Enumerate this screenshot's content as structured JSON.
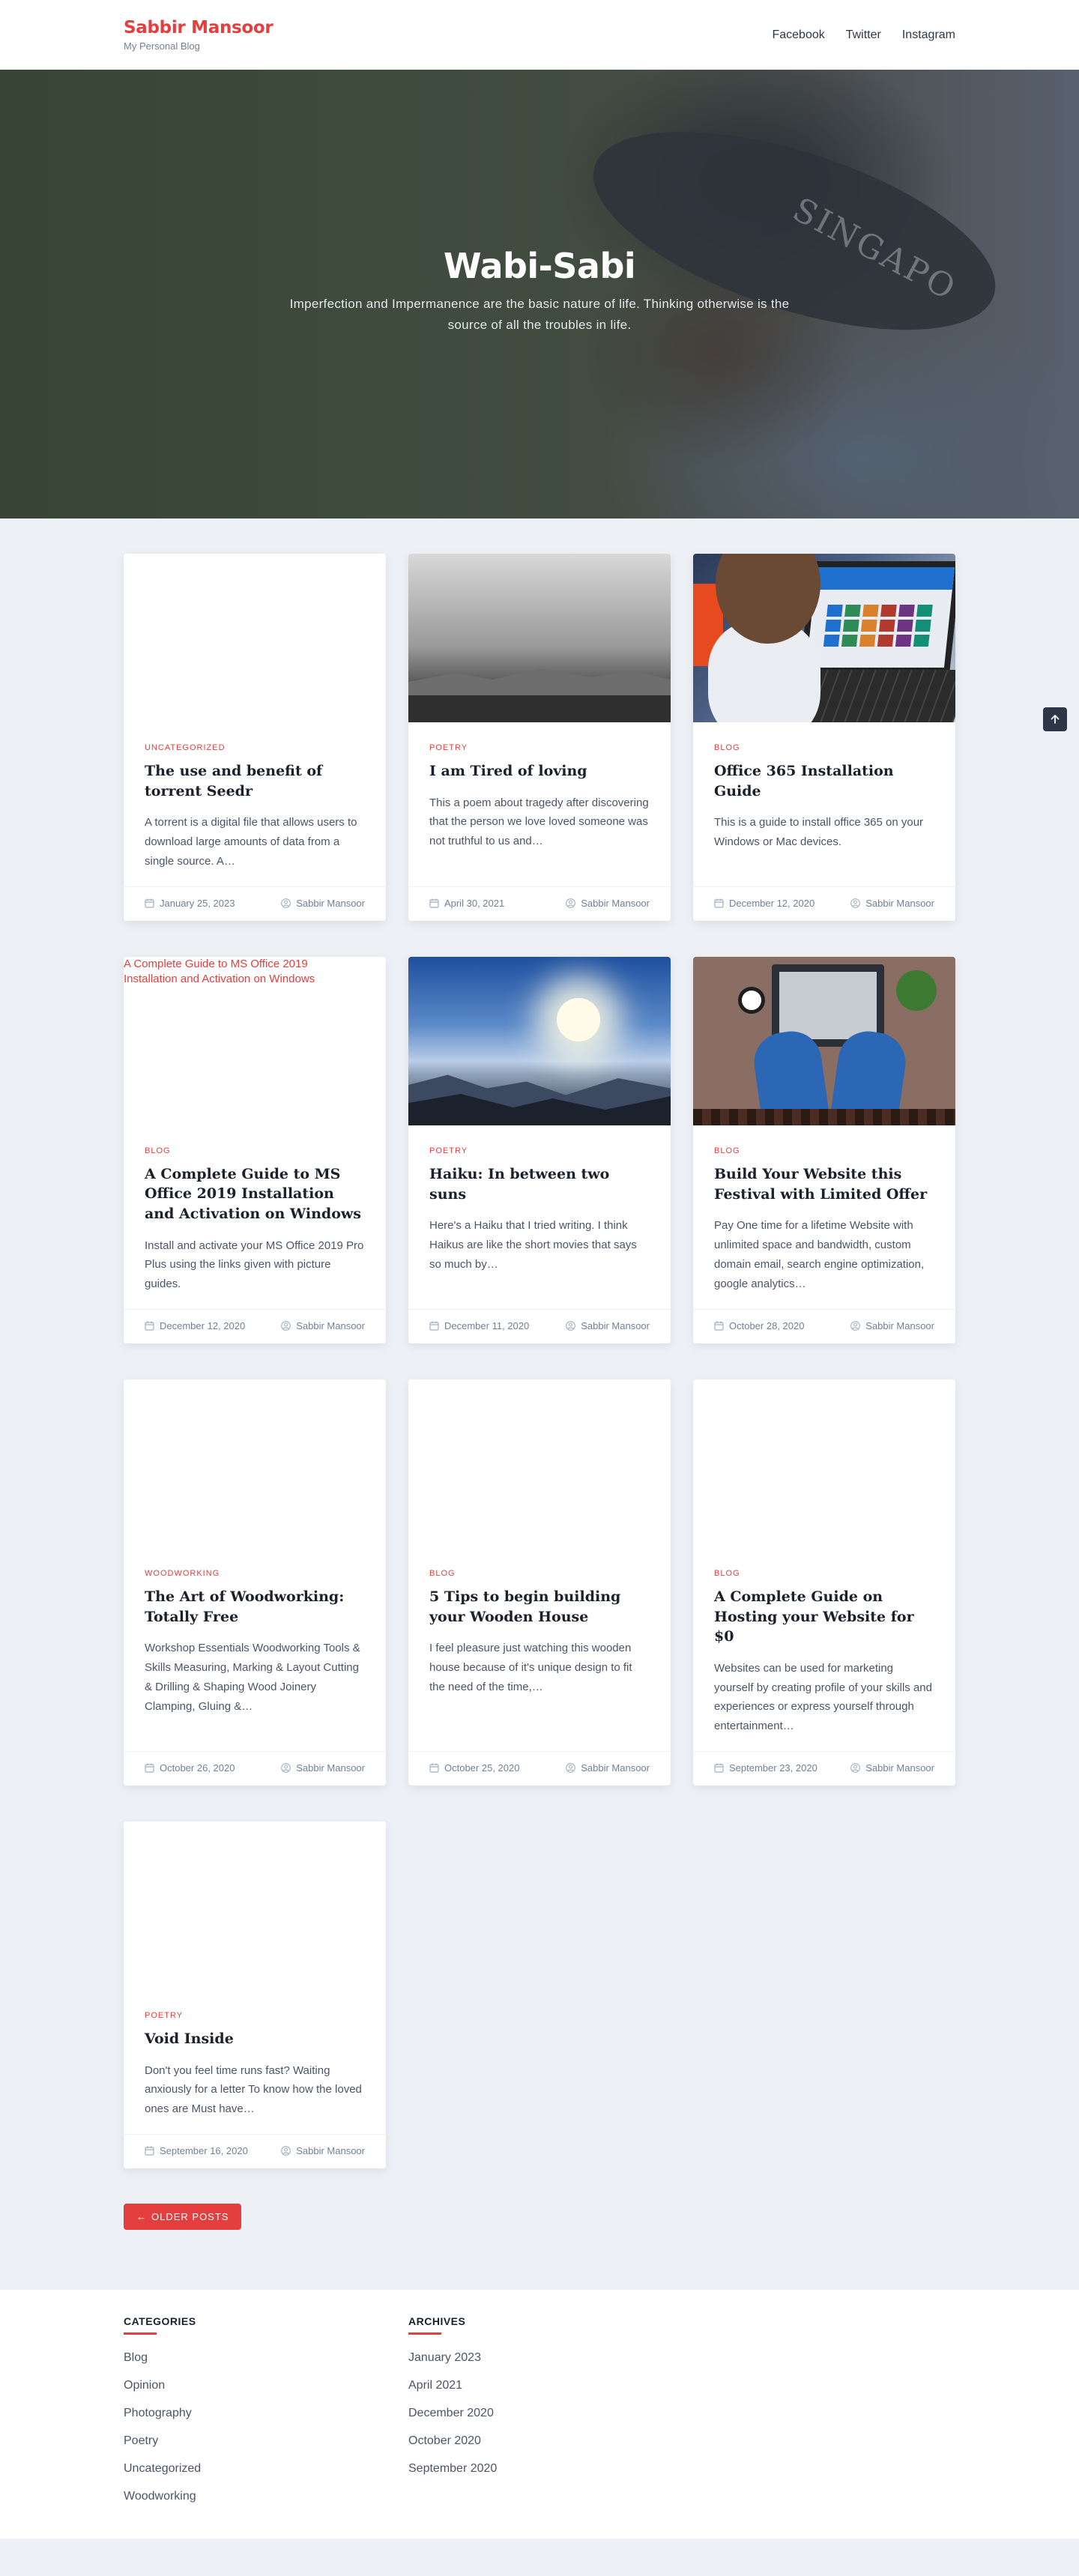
{
  "site": {
    "title": "Sabbir Mansoor",
    "tagline": "My Personal Blog"
  },
  "nav": [
    {
      "label": "Facebook"
    },
    {
      "label": "Twitter"
    },
    {
      "label": "Instagram"
    }
  ],
  "hero": {
    "title": "Wabi-Sabi",
    "subtitle": "Imperfection and Impermanence are the basic nature of life. Thinking otherwise is the source of all the troubles in life.",
    "hat_text": "SINGAPO"
  },
  "posts": [
    {
      "category": "UNCATEGORIZED",
      "title": "The use and benefit of torrent Seedr",
      "excerpt": "A torrent is a digital file that allows users to download large amounts of data from a single source. A…",
      "date": "January 25, 2023",
      "author": "Sabbir Mansoor"
    },
    {
      "category": "POETRY",
      "title": "I am Tired of loving",
      "excerpt": "This a poem about tragedy after discovering that the person we love loved someone was not truthful to us and…",
      "date": "April 30, 2021",
      "author": "Sabbir Mansoor",
      "image": "sculpture"
    },
    {
      "category": "BLOG",
      "title": "Office 365 Installation Guide",
      "excerpt": "This is a guide to install office 365 on your Windows or Mac devices.",
      "date": "December 12, 2020",
      "author": "Sabbir Mansoor",
      "image": "laptop"
    },
    {
      "category": "BLOG",
      "title": "A Complete Guide to MS Office 2019 Installation and Activation on Windows",
      "excerpt": "Install and activate your MS Office 2019 Pro Plus using the links given with picture guides.",
      "date": "December 12, 2020",
      "author": "Sabbir Mansoor",
      "image_alt": "A Complete Guide to MS Office 2019 Installation and Activation on Windows"
    },
    {
      "category": "POETRY",
      "title": "Haiku: In between two suns",
      "excerpt": "Here's a Haiku that I tried writing. I think Haikus are like the short movies that says so much by…",
      "date": "December 11, 2020",
      "author": "Sabbir Mansoor",
      "image": "sun"
    },
    {
      "category": "BLOG",
      "title": "Build Your Website this Festival with Limited Offer",
      "excerpt": "Pay One time for a lifetime Website with unlimited space and bandwidth, custom domain email, search engine optimization, google analytics…",
      "date": "October 28, 2020",
      "author": "Sabbir Mansoor",
      "image": "desk"
    },
    {
      "category": "WOODWORKING",
      "title": "The Art of Woodworking: Totally Free",
      "excerpt": "Workshop Essentials Woodworking Tools & Skills Measuring, Marking & Layout Cutting & Drilling & Shaping Wood Joinery Clamping, Gluing &…",
      "date": "October 26, 2020",
      "author": "Sabbir Mansoor"
    },
    {
      "category": "BLOG",
      "title": "5 Tips to begin building your Wooden House",
      "excerpt": "I feel pleasure just watching this wooden house because of it's unique design to fit the need of the time,…",
      "date": "October 25, 2020",
      "author": "Sabbir Mansoor"
    },
    {
      "category": "BLOG",
      "title": "A Complete Guide on Hosting your Website for $0",
      "excerpt": "Websites can be used for marketing yourself by creating profile of your skills and experiences or express yourself through entertainment…",
      "date": "September 23, 2020",
      "author": "Sabbir Mansoor"
    },
    {
      "category": "POETRY",
      "title": "Void Inside",
      "excerpt": "Don't you feel time runs fast? Waiting anxiously for a letter To know how the loved ones are  Must have…",
      "date": "September 16, 2020",
      "author": "Sabbir Mansoor"
    }
  ],
  "pager": {
    "older_label": "OLDER POSTS"
  },
  "footer": {
    "categories_title": "CATEGORIES",
    "categories": [
      "Blog",
      "Opinion",
      "Photography",
      "Poetry",
      "Uncategorized",
      "Woodworking"
    ],
    "archives_title": "ARCHIVES",
    "archives": [
      "January 2023",
      "April 2021",
      "December 2020",
      "October 2020",
      "September 2020"
    ]
  },
  "colors": {
    "accent": "#e53e3e",
    "page_bg": "#edf1f6",
    "text": "#1a202c"
  },
  "icons": {
    "date": "calendar-icon",
    "author": "user-circle-icon",
    "back_to_top": "arrow-up-icon",
    "older": "arrow-left-icon"
  }
}
